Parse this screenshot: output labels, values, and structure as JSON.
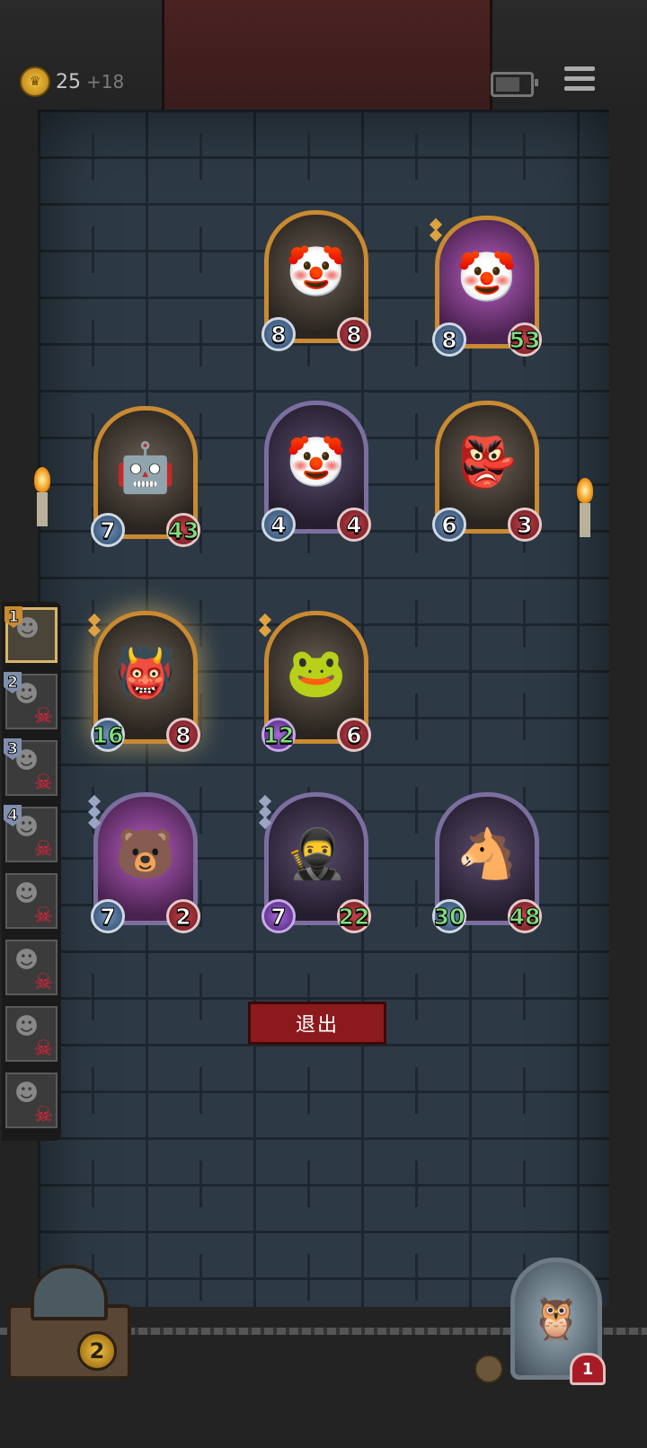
{
  "header": {
    "coins": "25",
    "coins_bonus": "+18",
    "coin_icon": "crown-coin-icon",
    "battery_icon": "battery-icon",
    "menu_icon": "menu-icon"
  },
  "board": [
    {
      "id": "clown-1",
      "atk": "8",
      "hp": "8",
      "frame": "gold",
      "hp_buff": false,
      "art": "🤡"
    },
    {
      "id": "clown-2",
      "atk": "8",
      "hp": "53",
      "frame": "gold",
      "hp_buff": true,
      "art": "🤡"
    },
    {
      "id": "robot",
      "atk": "7",
      "hp": "43",
      "frame": "gold",
      "hp_buff": true,
      "art": "🤖"
    },
    {
      "id": "clown-3",
      "atk": "4",
      "hp": "4",
      "frame": "purple",
      "hp_buff": false,
      "art": "🤡"
    },
    {
      "id": "masked",
      "atk": "6",
      "hp": "3",
      "frame": "gold",
      "hp_buff": false,
      "art": "👺"
    },
    {
      "id": "beast",
      "atk": "16",
      "hp": "8",
      "frame": "gold",
      "atk_buff": true,
      "art": "👹"
    },
    {
      "id": "frog",
      "atk": "12",
      "hp": "6",
      "frame": "gold",
      "atk_buff": true,
      "atk_poison": true,
      "art": "🐸"
    },
    {
      "id": "fire-bear",
      "atk": "7",
      "hp": "2",
      "frame": "purple",
      "art": "🐻"
    },
    {
      "id": "ninja",
      "atk": "7",
      "hp": "22",
      "frame": "purple",
      "hp_buff": true,
      "atk_poison": true,
      "art": "🥷"
    },
    {
      "id": "horse",
      "atk": "30",
      "hp": "48",
      "frame": "purple",
      "atk_buff": true,
      "hp_buff": true,
      "art": "🐴"
    }
  ],
  "roster": [
    {
      "num": "1",
      "eliminated": false,
      "active": true
    },
    {
      "num": "2",
      "eliminated": true
    },
    {
      "num": "3",
      "eliminated": true
    },
    {
      "num": "4",
      "eliminated": true
    },
    {
      "num": "",
      "eliminated": true
    },
    {
      "num": "",
      "eliminated": true
    },
    {
      "num": "",
      "eliminated": true
    },
    {
      "num": "",
      "eliminated": true
    }
  ],
  "exit_label": "退出",
  "chest_count": "2",
  "hero_health": "1"
}
